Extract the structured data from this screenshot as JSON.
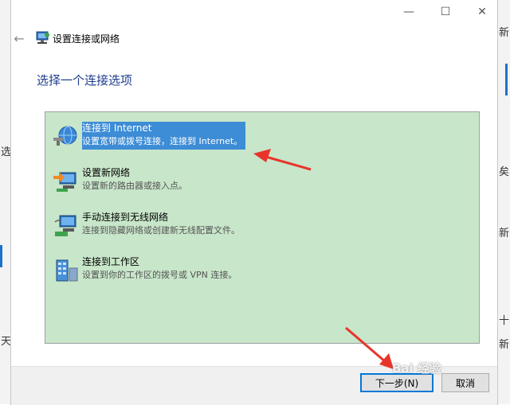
{
  "background_app": {
    "left_glyphs": [
      "选",
      "天"
    ],
    "right_glyphs": [
      "新",
      "矣",
      "新",
      "十",
      "新"
    ]
  },
  "window": {
    "title": "设置连接或网络",
    "controls": {
      "minimize": "—",
      "maximize": "☐",
      "close": "✕"
    }
  },
  "heading": "选择一个连接选项",
  "options": [
    {
      "title": "连接到 Internet",
      "desc": "设置宽带或拨号连接，连接到 Internet。",
      "icon": "globe-network-icon",
      "selected": true
    },
    {
      "title": "设置新网络",
      "desc": "设置新的路由器或接入点。",
      "icon": "router-setup-icon",
      "selected": false
    },
    {
      "title": "手动连接到无线网络",
      "desc": "连接到隐藏网络或创建新无线配置文件。",
      "icon": "wireless-computer-icon",
      "selected": false
    },
    {
      "title": "连接到工作区",
      "desc": "设置到你的工作区的拨号或 VPN 连接。",
      "icon": "workplace-building-icon",
      "selected": false
    }
  ],
  "buttons": {
    "next": "下一步(N)",
    "cancel": "取消"
  },
  "watermark": "Bai 经验",
  "colors": {
    "selection": "#3d8cd6",
    "options_bg": "#c8e6c9",
    "heading": "#1e3d8f",
    "arrow": "#e8352b"
  }
}
